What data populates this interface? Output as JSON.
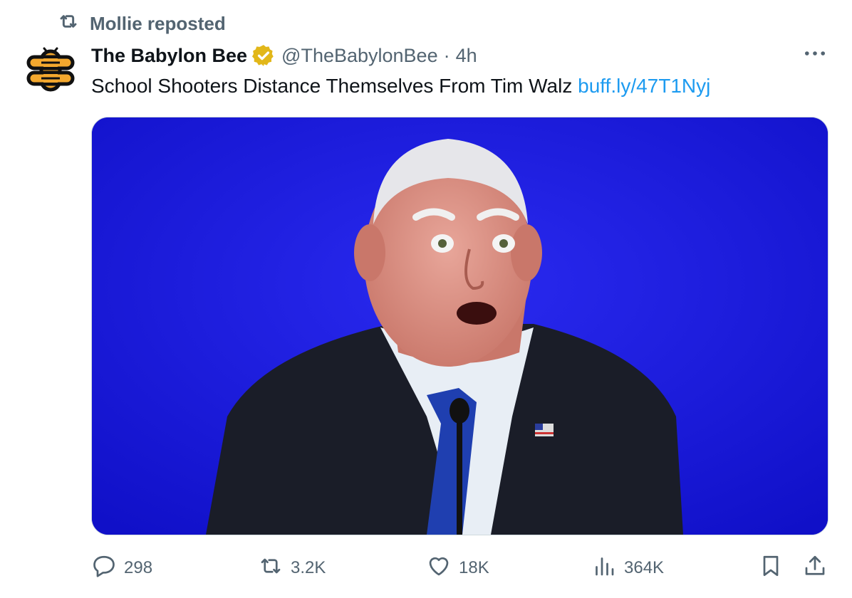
{
  "repost": {
    "label": "Mollie reposted",
    "icon": "repost-icon"
  },
  "author": {
    "name": "The Babylon Bee",
    "handle": "@TheBabylonBee",
    "separator": "·",
    "time": "4h",
    "verified_color": "#e2b719"
  },
  "tweet": {
    "text": "School Shooters Distance Themselves From Tim Walz ",
    "link": "buff.ly/47T1Nyj"
  },
  "actions": {
    "replies": "298",
    "reposts": "3.2K",
    "likes": "18K",
    "views": "364K"
  },
  "colors": {
    "text": "#0f1419",
    "muted": "#536471",
    "link": "#1d9bf0",
    "media_background": "#1414e0"
  }
}
